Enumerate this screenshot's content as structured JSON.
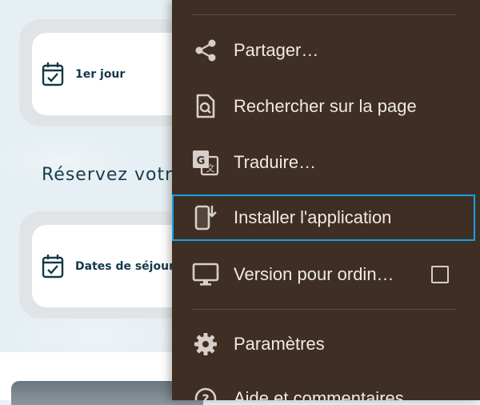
{
  "page": {
    "cards": [
      {
        "label": "1er jour",
        "icon": "calendar-check-icon"
      },
      {
        "label": "Dates de séjour",
        "icon": "calendar-check-icon"
      }
    ],
    "section_title": "Réservez votr"
  },
  "menu": {
    "items": [
      {
        "label": "Partager…",
        "icon": "share-icon"
      },
      {
        "label": "Rechercher sur la page",
        "icon": "find-in-page-icon"
      },
      {
        "label": "Traduire…",
        "icon": "translate-icon"
      },
      {
        "label": "Installer l'application",
        "icon": "install-app-icon",
        "focused": true
      },
      {
        "label": "Version pour ordin…",
        "icon": "desktop-icon",
        "checkbox_checked": false
      },
      {
        "label": "Paramètres",
        "icon": "gear-icon"
      },
      {
        "label": "Aide et commentaires",
        "icon": "help-icon"
      }
    ]
  },
  "colors": {
    "menu_background": "#3e2e24",
    "menu_text": "#f1e9e3",
    "focus_outline": "#18a1e0",
    "card_text": "#16384a"
  }
}
